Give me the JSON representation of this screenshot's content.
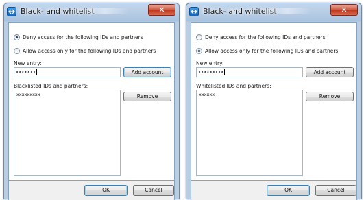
{
  "dialogs": [
    {
      "id": "left",
      "title": "Black- and whitelist",
      "close_glyph": "✕",
      "radio_options": [
        {
          "label": "Deny access for the following IDs and partners",
          "checked": true
        },
        {
          "label": "Allow access only for the following IDs and partners",
          "checked": false
        }
      ],
      "new_entry_label": "New entry:",
      "new_entry_value": "xxxxxxx",
      "add_button_label": "Add account",
      "list_label": "Blacklisted IDs and partners:",
      "list_items": [
        "xxxxxxxxx"
      ],
      "remove_button_label": "Remove",
      "ok_label": "OK",
      "cancel_label": "Cancel"
    },
    {
      "id": "right",
      "title": "Black- and whitelist",
      "close_glyph": "✕",
      "radio_options": [
        {
          "label": "Deny access for the following IDs and partners",
          "checked": false
        },
        {
          "label": "Allow access only for the following IDs and partners",
          "checked": true
        }
      ],
      "new_entry_label": "New entry:",
      "new_entry_value": "xxxxxxxxx",
      "add_button_label": "Add account",
      "list_label": "Whitelisted IDs and partners:",
      "list_items": [
        "xxxxxx"
      ],
      "remove_button_label": "Remove",
      "ok_label": "OK",
      "cancel_label": "Cancel"
    }
  ],
  "colors": {
    "title_gradient_top": "#c4d7ec",
    "close_button": "#c23a20",
    "default_button_border": "#3c7fb1"
  },
  "icons": {
    "title_icon": "teamviewer-app-icon",
    "close_icon": "close-x-icon"
  }
}
